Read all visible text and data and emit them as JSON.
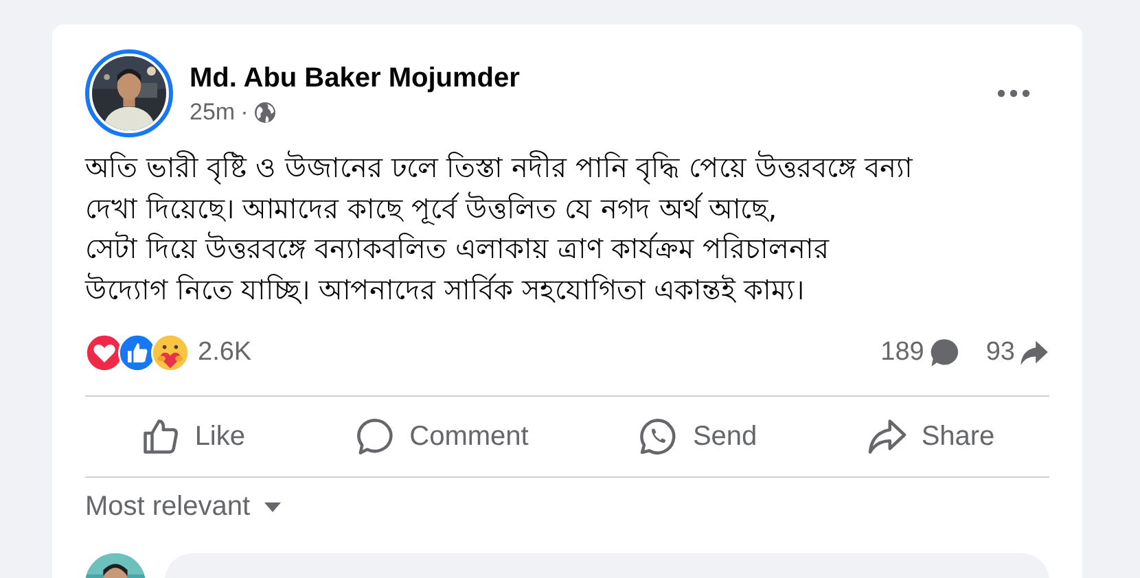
{
  "post": {
    "author": "Md. Abu Baker Mojumder",
    "time": "25m",
    "audience_separator": "·",
    "text_lines": [
      "অতি ভারী বৃষ্টি ও উজানের ঢলে তিস্তা নদীর পানি বৃদ্ধি পেয়ে উত্তরবঙ্গে বন্যা",
      "দেখা দিয়েছে। আমাদের কাছে পূর্বে উত্তলিত যে নগদ অর্থ আছে,",
      "সেটা দিয়ে উত্তরবঙ্গে বন্যাকবলিত এলাকায় ত্রাণ কার্যক্রম পরিচালনার",
      "উদ্যোগ নিতে যাচ্ছি। আপনাদের সার্বিক সহযোগিতা একান্তই কাম্য।"
    ]
  },
  "reactions": {
    "icons": [
      {
        "kind": "love"
      },
      {
        "kind": "like"
      },
      {
        "kind": "care"
      }
    ],
    "count": "2.6K",
    "comments": "189",
    "shares": "93"
  },
  "actions": [
    {
      "kind": "like",
      "label": "Like"
    },
    {
      "kind": "comment",
      "label": "Comment"
    },
    {
      "kind": "send",
      "label": "Send"
    },
    {
      "kind": "share",
      "label": "Share"
    }
  ],
  "comments_sort": {
    "label": "Most relevant"
  }
}
